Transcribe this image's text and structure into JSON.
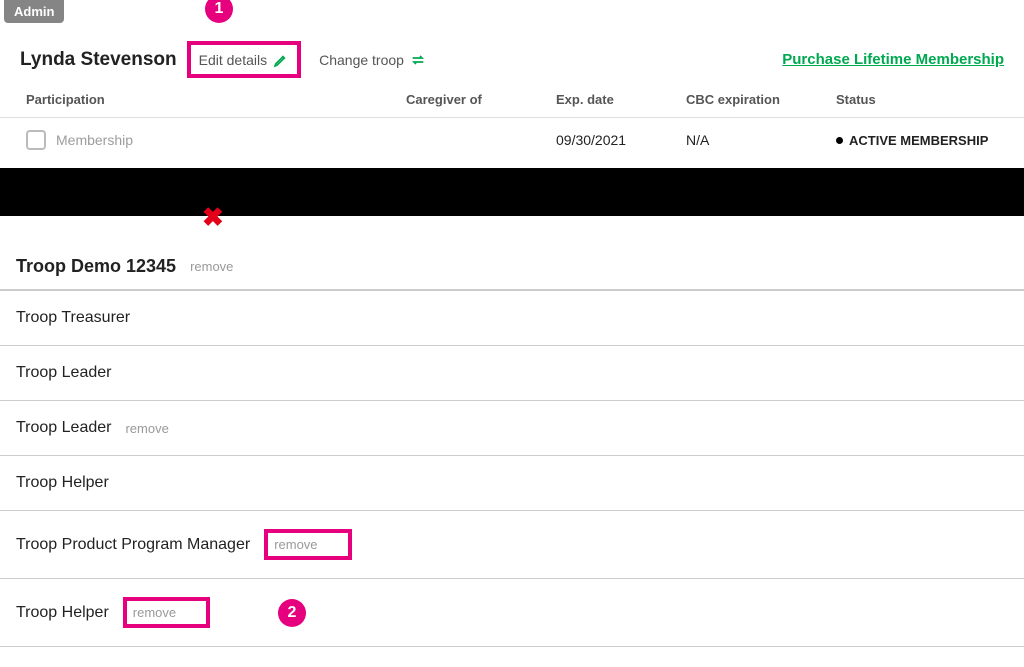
{
  "badge": "Admin",
  "member": {
    "name": "Lynda Stevenson"
  },
  "actions": {
    "edit_details": "Edit details",
    "change_troop": "Change troop",
    "purchase": "Purchase Lifetime Membership"
  },
  "annotations": {
    "n1": "1",
    "x": "✖",
    "n2": "2"
  },
  "table": {
    "headers": {
      "participation": "Participation",
      "caregiver": "Caregiver of",
      "exp": "Exp. date",
      "cbc": "CBC expiration",
      "status": "Status"
    },
    "row": {
      "participation": "Membership",
      "caregiver": "",
      "exp": "09/30/2021",
      "cbc": "N/A",
      "status": "ACTIVE MEMBERSHIP"
    }
  },
  "troop": {
    "title": "Troop Demo 12345",
    "remove": "remove",
    "roles": [
      {
        "name": "Troop Treasurer",
        "removable": false,
        "highlight": false
      },
      {
        "name": "Troop Leader",
        "removable": false,
        "highlight": false
      },
      {
        "name": "Troop Leader",
        "removable": true,
        "highlight": false
      },
      {
        "name": "Troop Helper",
        "removable": false,
        "highlight": false
      },
      {
        "name": "Troop Product Program Manager",
        "removable": true,
        "highlight": true
      },
      {
        "name": "Troop Helper",
        "removable": true,
        "highlight": true,
        "annot2": true
      }
    ]
  }
}
